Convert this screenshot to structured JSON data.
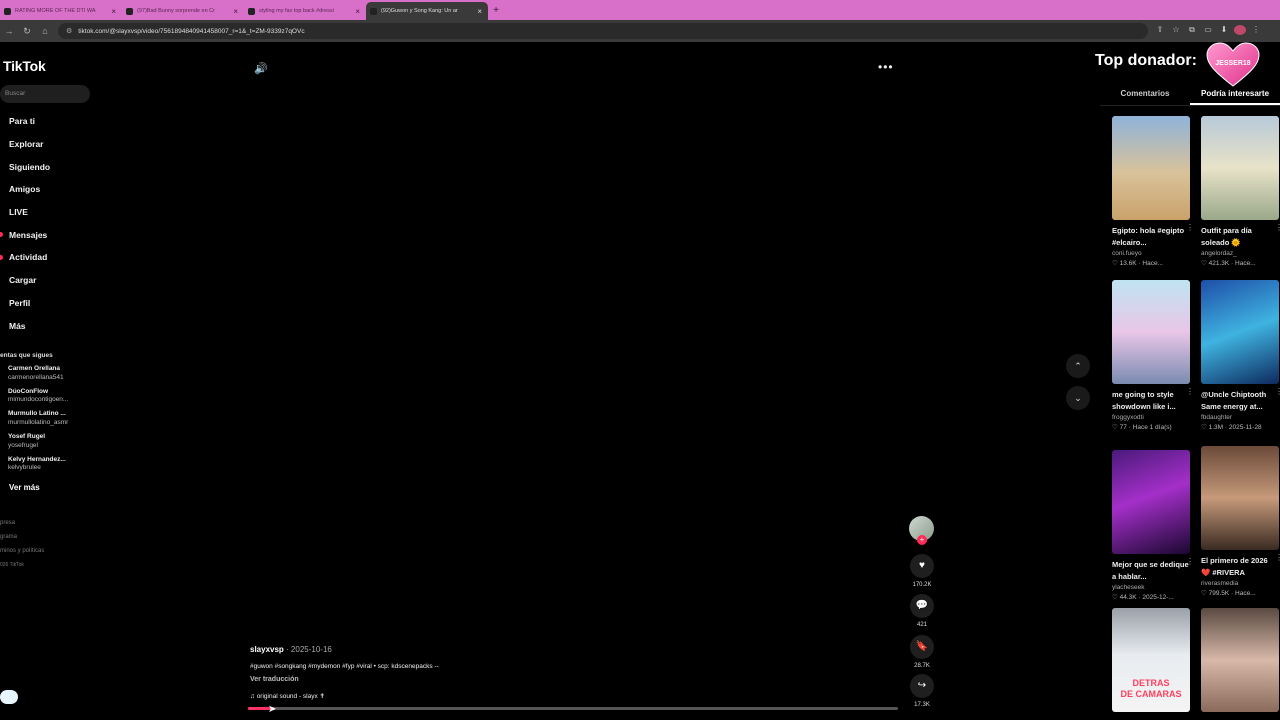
{
  "browser": {
    "tabs": [
      {
        "label": "RATING MORE OF THE DTI WA",
        "active": false
      },
      {
        "label": "(97)Bad Bunny sorprende en Cr",
        "active": false
      },
      {
        "label": "styling my fav top back #dressi",
        "active": false
      },
      {
        "label": "(92)Guwon y Song Kang: Un ar",
        "active": true
      }
    ],
    "url": "tiktok.com/@slayxvsp/video/7561894840941458007_r=1&_t=ZM-9339z7qOVc"
  },
  "sidebar": {
    "logo": "TikTok",
    "search_placeholder": "Buscar",
    "nav": [
      {
        "label": "Para ti",
        "dot": false
      },
      {
        "label": "Explorar",
        "dot": false
      },
      {
        "label": "Siguiendo",
        "dot": false
      },
      {
        "label": "Amigos",
        "dot": false
      },
      {
        "label": "LIVE",
        "dot": false
      },
      {
        "label": "Mensajes",
        "dot": true
      },
      {
        "label": "Actividad",
        "dot": true
      },
      {
        "label": "Cargar",
        "dot": false
      },
      {
        "label": "Perfil",
        "dot": false
      },
      {
        "label": "Más",
        "dot": false
      }
    ],
    "following_title": "entas que sigues",
    "following": [
      {
        "name": "Carmen Orellana",
        "user": "carmenorellana541"
      },
      {
        "name": "DúoConFlow",
        "user": "mimundocontigoen..."
      },
      {
        "name": "Murmullo Latino ...",
        "user": "murmullolatino_asmr"
      },
      {
        "name": "Yosef Rugel",
        "user": "yosefrugel"
      },
      {
        "name": "Kelvy Hernandez...",
        "user": "kelvybrulee"
      }
    ],
    "see_more": "Ver más",
    "footer": [
      "presa",
      "grama",
      "minos y políticas",
      "026 TikTok"
    ]
  },
  "video": {
    "creator": "slayxvsp",
    "date": " · 2025-10-16",
    "caption": "#guwon #songkang #mydemon #fyp #viral • scp: kdscenepacks --",
    "translate": "Ver traducción",
    "sound": "original sound - slayx ✝",
    "progress": 0.04,
    "likes": "170.2K",
    "comments": "421",
    "saves": "28.7K",
    "shares": "17.3K"
  },
  "right_panel": {
    "donor_title": "Top donador:",
    "donor_name": "JESSER18",
    "tabs": [
      "Comentarios",
      "Podría interesarte"
    ],
    "active_tab": 1,
    "cards": [
      {
        "title": "Egipto: hola #egipto #elcairo...",
        "author": "coni.fueyo",
        "meta": "♡ 13.6K · Hace..."
      },
      {
        "title": "Outfit para día soleado 🌞",
        "author": "angelordaz_",
        "meta": "♡ 421.3K · Hace..."
      },
      {
        "title": "me going to style showdown like i...",
        "author": "froggyxodti",
        "meta": "♡ 77 · Hace 1 día(s)"
      },
      {
        "title": "@Uncle Chiptooth Same energy at...",
        "author": "fbdaughter",
        "meta": "♡ 1.3M · 2025-11-28"
      },
      {
        "title": "Mejor que se dedique a hablar...",
        "author": "ylacheseek",
        "meta": "♡ 44.3K · 2025-12-..."
      },
      {
        "title": "El primero de 2026 ❤️ #RIVERA",
        "author": "riverasmedia",
        "meta": "♡ 799.5K · Hace..."
      },
      {
        "title": "",
        "author": "",
        "meta": "",
        "overlay": "DETRAS\nDE CAMARAS"
      },
      {
        "title": "",
        "author": "",
        "meta": ""
      }
    ]
  }
}
